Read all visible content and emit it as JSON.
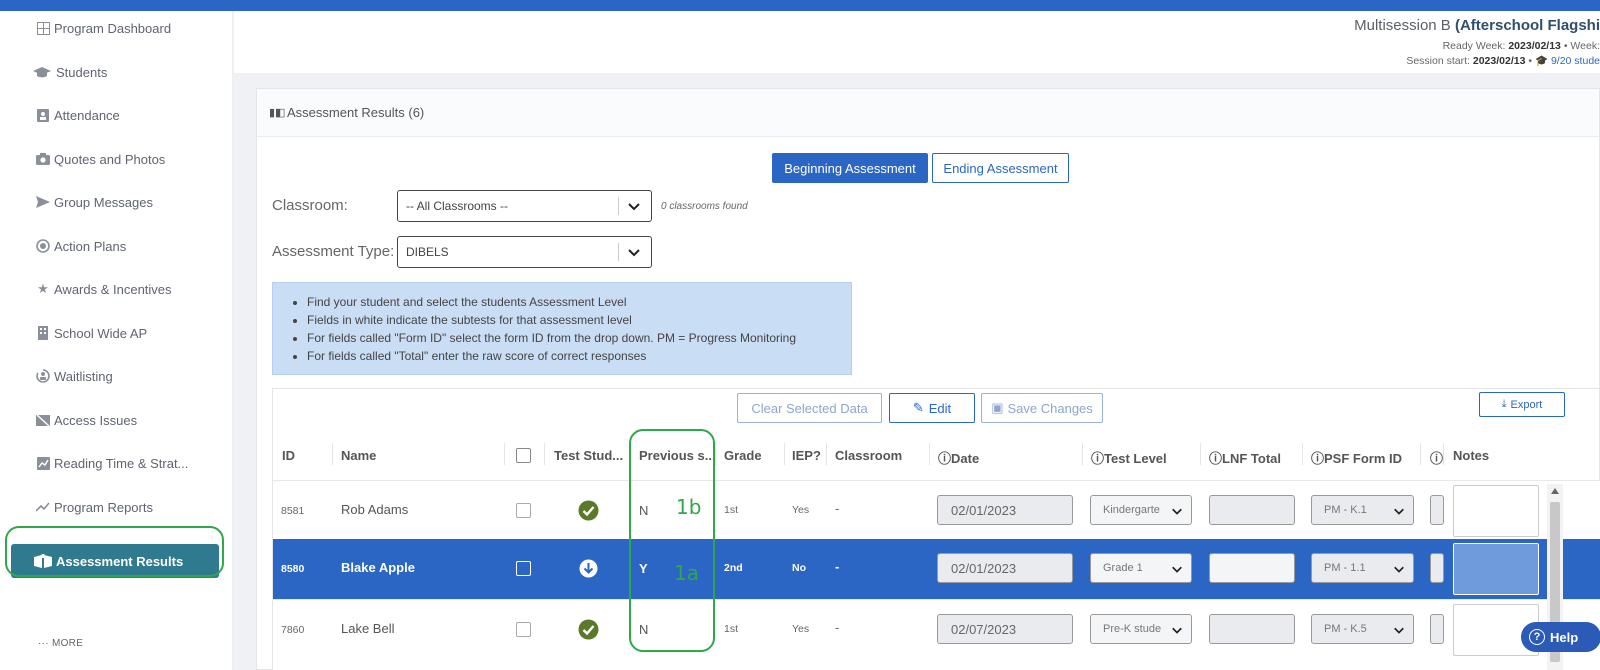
{
  "sidebar": {
    "items": [
      {
        "label": "Program Dashboard",
        "icon": "grid-icon"
      },
      {
        "label": "Students",
        "icon": "graduation-cap-icon"
      },
      {
        "label": "Attendance",
        "icon": "clipboard-user-icon"
      },
      {
        "label": "Quotes and Photos",
        "icon": "camera-icon"
      },
      {
        "label": "Group Messages",
        "icon": "paper-plane-icon"
      },
      {
        "label": "Action Plans",
        "icon": "target-icon"
      },
      {
        "label": "Awards & Incentives",
        "icon": "award-icon"
      },
      {
        "label": "School Wide AP",
        "icon": "building-icon"
      },
      {
        "label": "Waitlisting",
        "icon": "user-clock-icon"
      },
      {
        "label": "Access Issues",
        "icon": "blocked-icon"
      },
      {
        "label": "Reading Time & Strat...",
        "icon": "chart-box-icon"
      },
      {
        "label": "Program Reports",
        "icon": "trend-icon"
      }
    ],
    "active": {
      "label": "Assessment Results",
      "icon": "book-open-reader-icon"
    },
    "more_label": "MORE"
  },
  "header": {
    "title_prefix": "Multisession B",
    "title_bold": "(Afterschool Flagshi",
    "ready_week_label": "Ready Week:",
    "ready_week_value": "2023/02/13",
    "week_label": "Week:",
    "session_start_label": "Session start:",
    "session_start_value": "2023/02/13",
    "students_text": "9/20 stude"
  },
  "panel": {
    "title": "Assessment Results (6)",
    "tabs": {
      "beginning": "Beginning Assessment",
      "ending": "Ending Assessment"
    },
    "classroom_label": "Classroom:",
    "classroom_value": "-- All Classrooms --",
    "classrooms_found": "0 classrooms found",
    "assessment_type_label": "Assessment Type:",
    "assessment_type_value": "DIBELS",
    "info": [
      "Find your student and select the students Assessment Level",
      "Fields in white indicate the subtests for that assessment level",
      "For fields called \"Form ID\" select the form ID from the drop down. PM = Progress Monitoring",
      "For fields called \"Total\" enter the raw score of correct responses"
    ],
    "toolbar": {
      "clear": "Clear Selected Data",
      "edit": "Edit",
      "save": "Save Changes",
      "export": "Export"
    }
  },
  "table": {
    "headers": {
      "id": "ID",
      "name": "Name",
      "test_student": "Test Stud...",
      "previous": "Previous s...",
      "grade": "Grade",
      "iep": "IEP?",
      "classroom": "Classroom",
      "date": "Date",
      "test_level": "Test Level",
      "lnf_total": "LNF Total",
      "psf_form_id": "PSF Form ID",
      "notes": "Notes"
    },
    "rows": [
      {
        "id": "8581",
        "name": "Blake Apple"
      }
    ]
  },
  "rows": [
    {
      "id": "8581",
      "name": "Rob Adams",
      "status": "check",
      "previous": "N",
      "grade": "1st",
      "iep": "Yes",
      "classroom": "-",
      "date": "02/01/2023",
      "test_level": "Kindergarte",
      "psf": "PM - K.1"
    },
    {
      "id": "8580",
      "name": "Blake Apple",
      "status": "download",
      "previous": "Y",
      "grade": "2nd",
      "iep": "No",
      "classroom": "-",
      "date": "02/01/2023",
      "test_level": "Grade 1",
      "psf": "PM - 1.1"
    },
    {
      "id": "7860",
      "name": "Lake Bell",
      "status": "check",
      "previous": "N",
      "grade": "1st",
      "iep": "Yes",
      "classroom": "-",
      "date": "02/07/2023",
      "test_level": "Pre-K stude",
      "psf": "PM - K.5"
    }
  ],
  "annotations": {
    "a1": "1b",
    "a2": "1a"
  },
  "help_label": "Help",
  "colors": {
    "topbar": "#2b66c4",
    "active_nav": "#2f7a8e",
    "selected_row": "#2b66c4",
    "annotation": "#2ea84b",
    "check": "#5a7a2a"
  }
}
